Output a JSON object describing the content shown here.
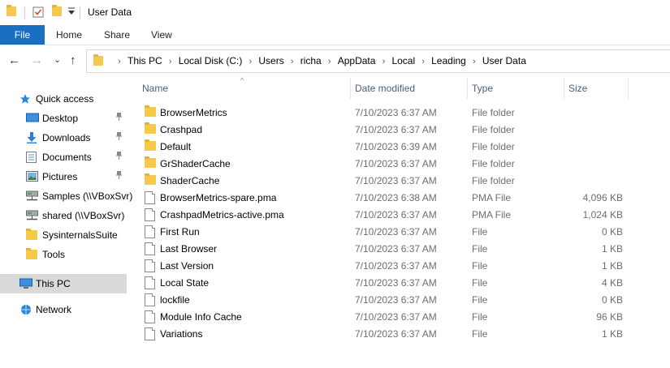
{
  "window": {
    "title": "User Data",
    "quick_access_icons": [
      "folder-icon",
      "properties-icon",
      "new-folder-icon",
      "customize-dropdown-icon"
    ]
  },
  "ribbon": {
    "file_label": "File",
    "tabs": [
      "Home",
      "Share",
      "View"
    ]
  },
  "nav": {
    "back_icon": "←",
    "forward_icon": "→",
    "recent_icon": "⌄",
    "up_icon": "↑"
  },
  "address": {
    "crumbs": [
      "This PC",
      "Local Disk (C:)",
      "Users",
      "richa",
      "AppData",
      "Local",
      "Leading",
      "User Data"
    ],
    "separator": "›"
  },
  "sidebar": {
    "items": [
      {
        "label": "Quick access",
        "icon": "star-icon",
        "pinned": false
      },
      {
        "label": "Desktop",
        "icon": "desktop-icon",
        "pinned": true
      },
      {
        "label": "Downloads",
        "icon": "download-arrow-icon",
        "pinned": true
      },
      {
        "label": "Documents",
        "icon": "document-icon",
        "pinned": true
      },
      {
        "label": "Pictures",
        "icon": "picture-icon",
        "pinned": true
      },
      {
        "label": "Samples (\\\\VBoxSvr)",
        "icon": "network-drive-icon",
        "pinned": false
      },
      {
        "label": "shared (\\\\VBoxSvr)",
        "icon": "network-drive-icon",
        "pinned": false
      },
      {
        "label": "SysinternalsSuite",
        "icon": "folder-icon",
        "pinned": false
      },
      {
        "label": "Tools",
        "icon": "folder-icon",
        "pinned": false
      },
      {
        "label": "This PC",
        "icon": "computer-icon",
        "pinned": false,
        "selected": true
      },
      {
        "label": "Network",
        "icon": "network-icon",
        "pinned": false
      }
    ],
    "pin_glyph": "📌"
  },
  "columns": {
    "name": "Name",
    "date": "Date modified",
    "type": "Type",
    "size": "Size",
    "sort_glyph": "^"
  },
  "files": [
    {
      "name": "BrowserMetrics",
      "date": "7/10/2023 6:37 AM",
      "type": "File folder",
      "size": "",
      "kind": "folder"
    },
    {
      "name": "Crashpad",
      "date": "7/10/2023 6:37 AM",
      "type": "File folder",
      "size": "",
      "kind": "folder"
    },
    {
      "name": "Default",
      "date": "7/10/2023 6:39 AM",
      "type": "File folder",
      "size": "",
      "kind": "folder"
    },
    {
      "name": "GrShaderCache",
      "date": "7/10/2023 6:37 AM",
      "type": "File folder",
      "size": "",
      "kind": "folder"
    },
    {
      "name": "ShaderCache",
      "date": "7/10/2023 6:37 AM",
      "type": "File folder",
      "size": "",
      "kind": "folder"
    },
    {
      "name": "BrowserMetrics-spare.pma",
      "date": "7/10/2023 6:38 AM",
      "type": "PMA File",
      "size": "4,096 KB",
      "kind": "file"
    },
    {
      "name": "CrashpadMetrics-active.pma",
      "date": "7/10/2023 6:37 AM",
      "type": "PMA File",
      "size": "1,024 KB",
      "kind": "file"
    },
    {
      "name": "First Run",
      "date": "7/10/2023 6:37 AM",
      "type": "File",
      "size": "0 KB",
      "kind": "file"
    },
    {
      "name": "Last Browser",
      "date": "7/10/2023 6:37 AM",
      "type": "File",
      "size": "1 KB",
      "kind": "file"
    },
    {
      "name": "Last Version",
      "date": "7/10/2023 6:37 AM",
      "type": "File",
      "size": "1 KB",
      "kind": "file"
    },
    {
      "name": "Local State",
      "date": "7/10/2023 6:37 AM",
      "type": "File",
      "size": "4 KB",
      "kind": "file"
    },
    {
      "name": "lockfile",
      "date": "7/10/2023 6:37 AM",
      "type": "File",
      "size": "0 KB",
      "kind": "file"
    },
    {
      "name": "Module Info Cache",
      "date": "7/10/2023 6:37 AM",
      "type": "File",
      "size": "96 KB",
      "kind": "file"
    },
    {
      "name": "Variations",
      "date": "7/10/2023 6:37 AM",
      "type": "File",
      "size": "1 KB",
      "kind": "file"
    }
  ],
  "colors": {
    "file_tab_bg": "#1a6fc4",
    "selected_bg": "#d9d9d9",
    "folder": "#f6c94b",
    "header_text": "#4c607a"
  }
}
